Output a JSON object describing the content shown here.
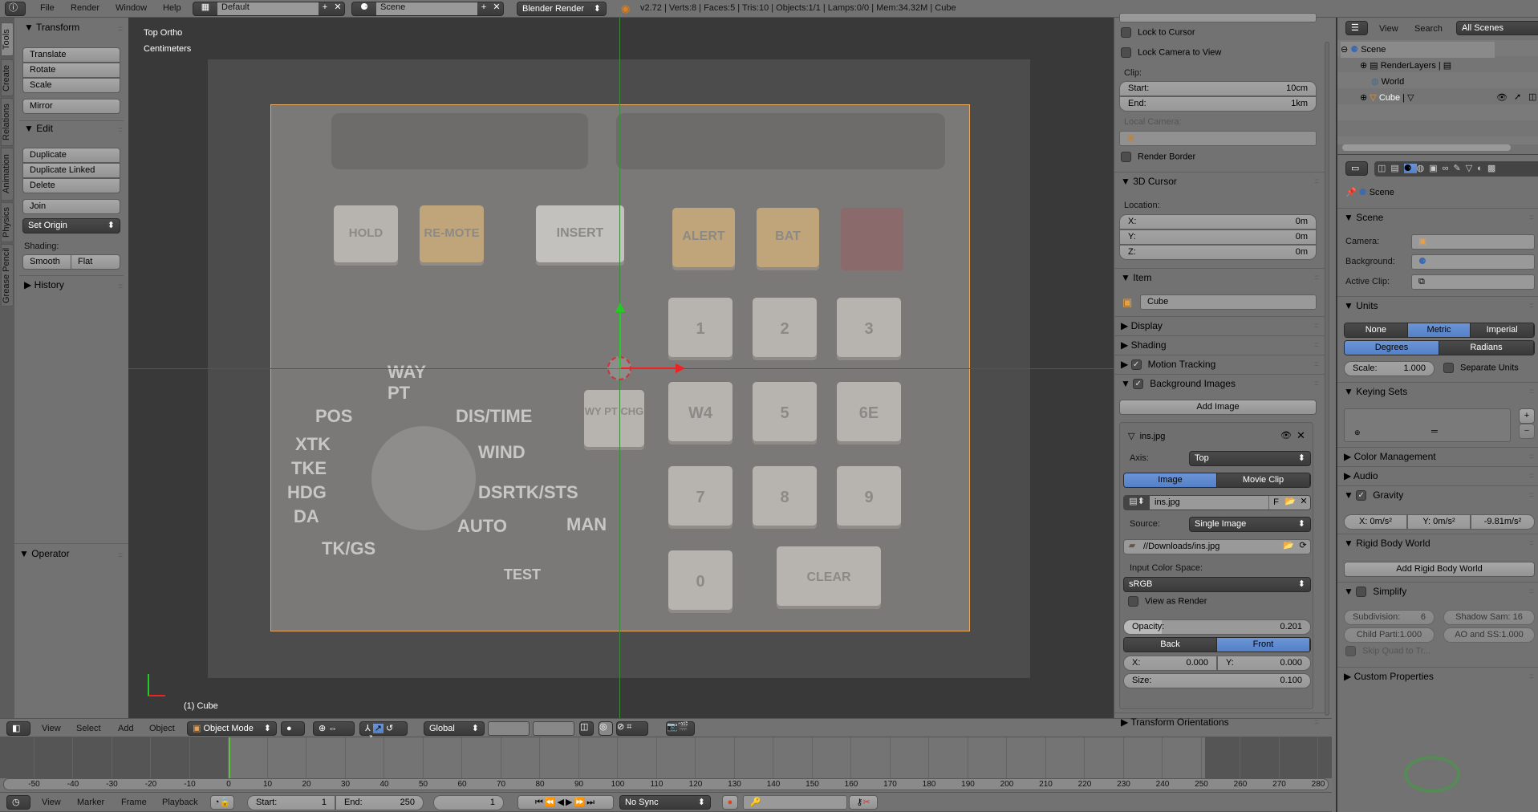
{
  "topbar": {
    "menus": [
      "File",
      "Render",
      "Window",
      "Help"
    ],
    "layout": "Default",
    "scene": "Scene",
    "engine": "Blender Render",
    "stats": "v2.72 | Verts:8 | Faces:5 | Tris:10 | Objects:1/1 | Lamps:0/0 | Mem:34.32M | Cube"
  },
  "tool_tabs": [
    "Tools",
    "Create",
    "Relations",
    "Animation",
    "Physics",
    "Grease Pencil"
  ],
  "tools": {
    "transform": "Transform",
    "translate": "Translate",
    "rotate": "Rotate",
    "scale": "Scale",
    "mirror": "Mirror",
    "edit": "Edit",
    "duplicate": "Duplicate",
    "duplicate_linked": "Duplicate Linked",
    "delete": "Delete",
    "join": "Join",
    "set_origin": "Set Origin",
    "shading": "Shading:",
    "smooth": "Smooth",
    "flat": "Flat",
    "history": "History",
    "operator": "Operator"
  },
  "viewport": {
    "view_name": "Top Ortho",
    "units": "Centimeters",
    "object_label": "(1) Cube",
    "key_labels": [
      "HOLD",
      "RE-MOTE",
      "INSERT",
      "ALERT",
      "BAT",
      "1",
      "2",
      "3",
      "WY PT CHG",
      "W4",
      "5",
      "6E",
      "7",
      "8",
      "9",
      "0",
      "CLEAR"
    ],
    "dial_labels": [
      "WAY PT",
      "POS",
      "XTK",
      "TKE",
      "HDG",
      "DA",
      "DIS/TIME",
      "WIND",
      "DSRTK/STS",
      "AUTO",
      "MAN",
      "TK/GS",
      "TEST"
    ],
    "colors": {
      "x_axis": "#e02020",
      "y_axis": "#20c020",
      "border": "#e8a860"
    }
  },
  "view_header": {
    "menus": [
      "View",
      "Select",
      "Add",
      "Object"
    ],
    "mode": "Object Mode",
    "orientation": "Global"
  },
  "npanel": {
    "lock_cursor": "Lock to Cursor",
    "lock_camera": "Lock Camera to View",
    "clip": "Clip:",
    "clip_start_label": "Start:",
    "clip_start": "10cm",
    "clip_end_label": "End:",
    "clip_end": "1km",
    "local_camera": "Local Camera:",
    "render_border": "Render Border",
    "cursor": "3D Cursor",
    "location": "Location:",
    "x_label": "X:",
    "x": "0m",
    "y_label": "Y:",
    "y": "0m",
    "z_label": "Z:",
    "z": "0m",
    "item": "Item",
    "item_name": "Cube",
    "display": "Display",
    "shading": "Shading",
    "motion_tracking": "Motion Tracking",
    "background_images": "Background Images",
    "add_image": "Add Image",
    "bg_name": "ins.jpg",
    "axis_label": "Axis:",
    "axis": "Top",
    "image": "Image",
    "movie_clip": "Movie Clip",
    "file": "ins.jpg",
    "f": "F",
    "source_label": "Source:",
    "source": "Single Image",
    "path": "//Downloads/ins.jpg",
    "color_space_label": "Input Color Space:",
    "color_space": "sRGB",
    "view_as_render": "View as Render",
    "opacity_label": "Opacity:",
    "opacity": 0.201,
    "opacity_text": "0.201",
    "back": "Back",
    "front": "Front",
    "bx_label": "X:",
    "bx": "0.000",
    "by_label": "Y:",
    "by": "0.000",
    "size_label": "Size:",
    "size": "0.100",
    "transform_orientations": "Transform Orientations"
  },
  "outliner": {
    "menus": [
      "View",
      "Search"
    ],
    "filter": "All Scenes",
    "items": [
      "Scene",
      "RenderLayers",
      "World",
      "Cube"
    ]
  },
  "properties": {
    "context": "Scene",
    "scene_panel": "Scene",
    "camera": "Camera:",
    "background": "Background:",
    "active_clip": "Active Clip:",
    "units": "Units",
    "unit_systems": [
      "None",
      "Metric",
      "Imperial"
    ],
    "rotation": [
      "Degrees",
      "Radians"
    ],
    "scale_label": "Scale:",
    "scale": "1.000",
    "separate_units": "Separate Units",
    "keying_sets": "Keying Sets",
    "color_management": "Color Management",
    "audio": "Audio",
    "gravity": "Gravity",
    "gx": "X:   0m/s²",
    "gy": "Y:   0m/s²",
    "gz": "-9.81m/s²",
    "rigid_body": "Rigid Body World",
    "add_rigid": "Add Rigid Body World",
    "simplify": "Simplify",
    "subdivision": "Subdivision:",
    "subdivision_val": "6",
    "shadow": "Shadow Sam: 16",
    "child": "Child Parti:1.000",
    "ao": "AO and SS:1.000",
    "skip_quad": "Skip Quad to Tr...",
    "custom_props": "Custom Properties"
  },
  "timeline": {
    "ticks": [
      -50,
      -40,
      -30,
      -20,
      -10,
      0,
      10,
      20,
      30,
      40,
      50,
      60,
      70,
      80,
      90,
      100,
      110,
      120,
      130,
      140,
      150,
      160,
      170,
      180,
      190,
      200,
      210,
      220,
      230,
      240,
      250,
      260,
      270,
      280
    ],
    "current_frame": 1,
    "range": [
      1,
      250
    ],
    "menus": [
      "View",
      "Marker",
      "Frame",
      "Playback"
    ],
    "start_label": "Start:",
    "start": "1",
    "end_label": "End:",
    "end": "250",
    "frame": "1",
    "sync": "No Sync"
  },
  "colors": {
    "accent": "#5680c2",
    "frame_line": "#60c040"
  }
}
